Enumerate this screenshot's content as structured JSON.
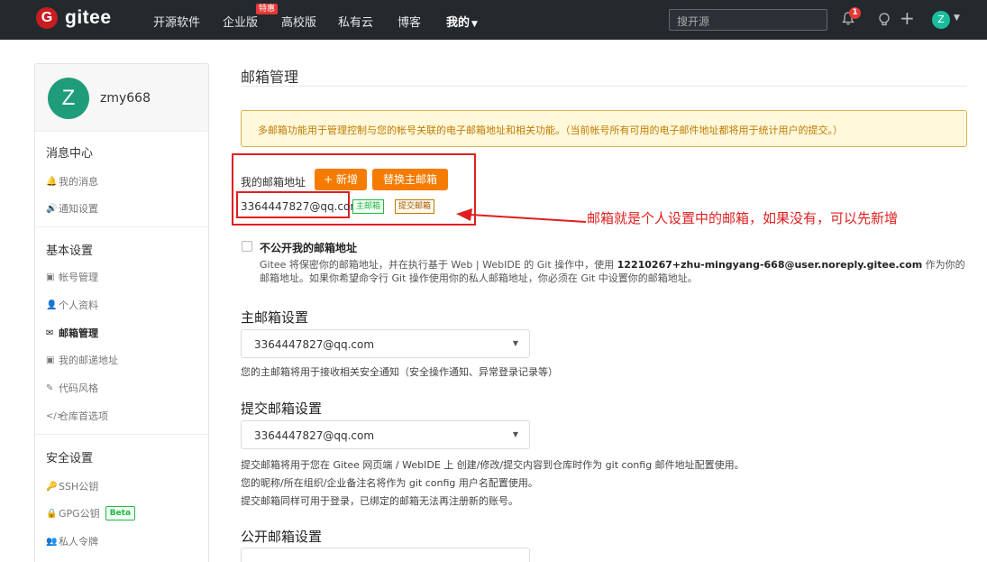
{
  "topbar": {
    "logo_mark": "G",
    "logo_text": "gitee",
    "nav": [
      "开源软件",
      "企业版",
      "高校版",
      "私有云",
      "博客"
    ],
    "badge": "特惠",
    "mine": "我的",
    "search_placeholder": "搜开源",
    "bell_count": "1",
    "avatar": "Z",
    "icons": [
      "bell-icon",
      "bulb-icon",
      "plus-icon"
    ]
  },
  "sidebar": {
    "user": {
      "avatar": "Z",
      "name": "zmy668"
    },
    "groups": [
      {
        "title": "消息中心",
        "items": [
          {
            "icon": "🔔",
            "icon_name": "bell-icon",
            "label": "我的消息"
          },
          {
            "icon": "🔊",
            "icon_name": "speaker-icon",
            "label": "通知设置"
          }
        ]
      },
      {
        "title": "基本设置",
        "items": [
          {
            "icon": "▣",
            "icon_name": "id-card-icon",
            "label": "帐号管理"
          },
          {
            "icon": "👤",
            "icon_name": "user-icon",
            "label": "个人资料"
          },
          {
            "icon": "✉",
            "icon_name": "mail-icon",
            "label": "邮箱管理",
            "active": true
          },
          {
            "icon": "▣",
            "icon_name": "address-card-icon",
            "label": "我的邮递地址"
          },
          {
            "icon": "✎",
            "icon_name": "brush-icon",
            "label": "代码风格"
          },
          {
            "icon": "</>",
            "icon_name": "code-icon",
            "label": "仓库首选项"
          }
        ]
      },
      {
        "title": "安全设置",
        "items": [
          {
            "icon": "🔑",
            "icon_name": "key-icon",
            "label": "SSH公钥"
          },
          {
            "icon": "🔒",
            "icon_name": "lock-icon",
            "label": "GPG公钥",
            "badge": "Beta"
          },
          {
            "icon": "👥",
            "icon_name": "token-icon",
            "label": "私人令牌"
          }
        ]
      }
    ]
  },
  "main": {
    "title": "邮箱管理",
    "notice": "多邮箱功能用于管理控制与您的帐号关联的电子邮箱地址和相关功能。（当前帐号所有可用的电子邮件地址都将用于统计用户的提交。）",
    "my_email_label": "我的邮箱地址",
    "add_button": "+ 新增",
    "switch_button": "替换主邮箱",
    "email": "3364447827@qq.com",
    "tag_primary": "主邮箱",
    "tag_commit": "提交邮箱",
    "annotation": "邮箱就是个人设置中的邮箱，如果没有，可以先新增",
    "private_label": "不公开我的邮箱地址",
    "private_desc_1": "Gitee 将保密你的邮箱地址，并在执行基于 Web | WebIDE 的 Git 操作中，使用 ",
    "private_desc_bold": "12210267+zhu-mingyang-668@user.noreply.gitee.com",
    "private_desc_2": " 作为你的邮箱地址。如果你希望命令行 Git 操作使用你的私人邮箱地址，你必须在 Git 中设置你的邮箱地址。",
    "primary_title": "主邮箱设置",
    "primary_value": "3364447827@qq.com",
    "primary_help": "您的主邮箱将用于接收相关安全通知（安全操作通知、异常登录记录等）",
    "commit_title": "提交邮箱设置",
    "commit_value": "3364447827@qq.com",
    "commit_help": [
      "提交邮箱将用于您在 Gitee 网页端 / WebIDE 上 创建/修改/提交内容到仓库时作为 git config 邮件地址配置使用。",
      "您的昵称/所在组织/企业备注名将作为 git config 用户名配置使用。",
      "提交邮箱同样可用于登录，已绑定的邮箱无法再注册新的账号。"
    ],
    "public_title": "公开邮箱设置"
  },
  "colors": {
    "accent": "#f57c00",
    "brand": "#c71d23",
    "annotation": "#e02020",
    "success": "#21ba45"
  }
}
